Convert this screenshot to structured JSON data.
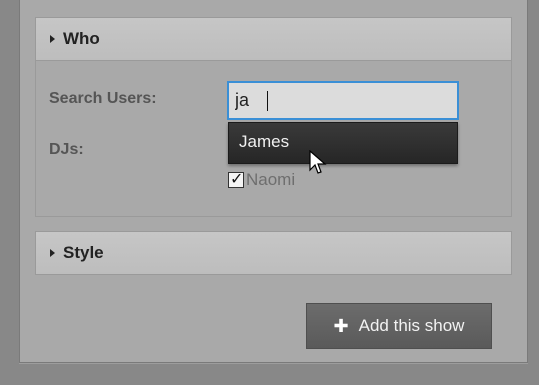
{
  "who_section": {
    "title": "Who",
    "search_label": "Search Users:",
    "search_value": "ja",
    "djs_label": "DJs:",
    "suggestion": "James",
    "checkbox_label": "Naomi",
    "checkbox_checked": true
  },
  "style_section": {
    "title": "Style"
  },
  "add_button": {
    "label": "Add this show",
    "icon": "plus-icon"
  },
  "colors": {
    "focus_border": "#3a8fd6",
    "dropdown_bg": "#2e2e2e",
    "button_bg": "#5f5f5f"
  }
}
